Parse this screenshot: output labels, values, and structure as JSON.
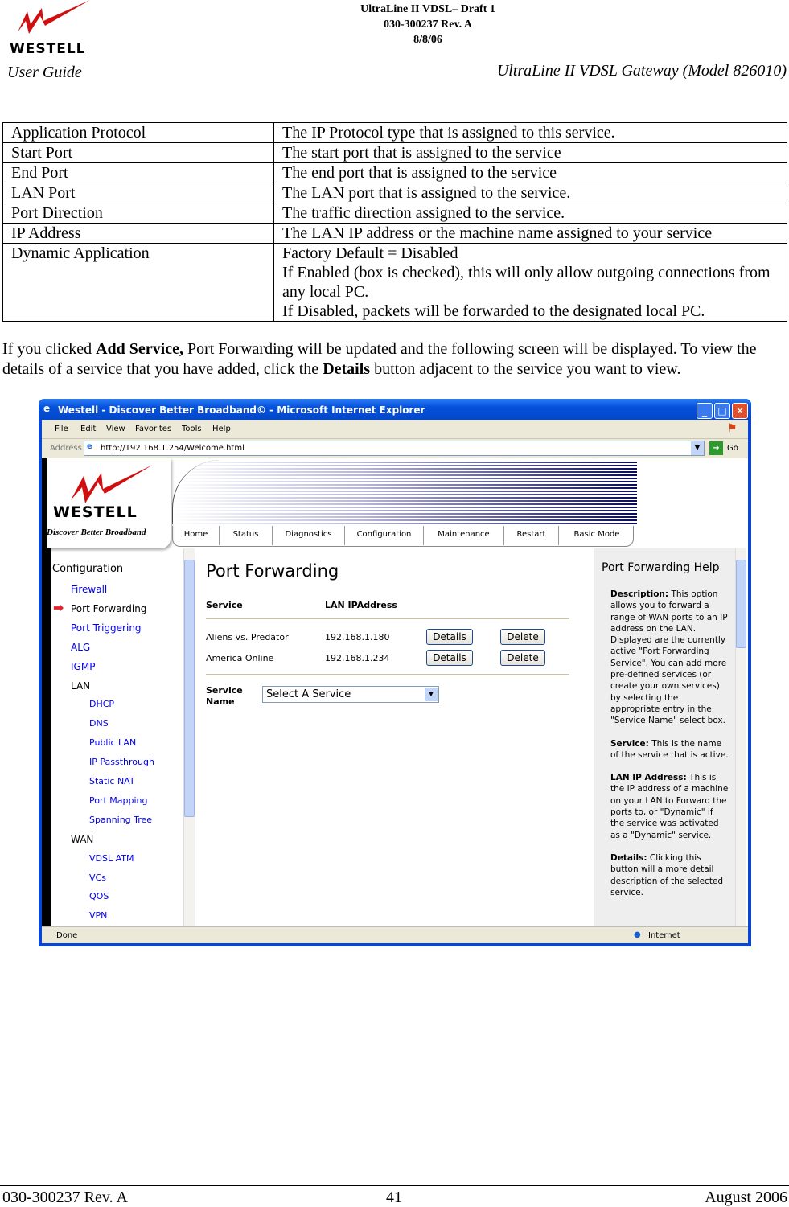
{
  "header": {
    "logo": "WESTELL",
    "line1": "UltraLine II VDSL– Draft 1",
    "line2": "030-300237 Rev. A",
    "line3": "8/8/06",
    "left": "User Guide",
    "right": "UltraLine II VDSL Gateway (Model 826010)"
  },
  "table": [
    {
      "term": "Application Protocol",
      "desc": [
        "The IP Protocol type that is assigned to this service."
      ]
    },
    {
      "term": "Start Port",
      "desc": [
        "The start port that is assigned to the service"
      ]
    },
    {
      "term": "End Port",
      "desc": [
        "The end port that is assigned to the service"
      ]
    },
    {
      "term": "LAN Port",
      "desc": [
        "The LAN port that is assigned to the service."
      ]
    },
    {
      "term": "Port Direction",
      "desc": [
        "The traffic direction assigned to the service."
      ]
    },
    {
      "term": "IP Address",
      "desc": [
        "The LAN IP address or the machine name assigned to your service"
      ]
    },
    {
      "term": "Dynamic Application",
      "desc": [
        "Factory Default = Disabled",
        "If Enabled (box is checked), this will only allow outgoing connections from any local PC.",
        "If Disabled, packets will be forwarded to the designated local PC."
      ]
    }
  ],
  "paragraph": {
    "p1": "If you clicked ",
    "b1": "Add Service,",
    "p2": " Port Forwarding will be updated and the following screen will be displayed. To view the details of a service that you have added, click the ",
    "b2": "Details",
    "p3": " button adjacent to the service you want to view."
  },
  "browser": {
    "title": "Westell - Discover Better Broadband© - Microsoft Internet Explorer",
    "menu": [
      "File",
      "Edit",
      "View",
      "Favorites",
      "Tools",
      "Help"
    ],
    "address_label": "Address",
    "url": "http://192.168.1.254/Welcome.html",
    "go": "Go",
    "status": "Done",
    "zone": "Internet"
  },
  "banner": {
    "logo": "WESTELL",
    "tagline": "Discover Better Broadband",
    "nav": [
      "Home",
      "Status",
      "Diagnostics",
      "Configuration",
      "Maintenance",
      "Restart",
      "Basic Mode"
    ]
  },
  "sidebar": {
    "heading": "Configuration",
    "items": [
      {
        "label": "Firewall",
        "level": 1,
        "link": true
      },
      {
        "label": "Port Forwarding",
        "level": 1,
        "link": false,
        "active": true
      },
      {
        "label": "Port Triggering",
        "level": 1,
        "link": true
      },
      {
        "label": "ALG",
        "level": 1,
        "link": true
      },
      {
        "label": "IGMP",
        "level": 1,
        "link": true
      },
      {
        "label": "LAN",
        "level": 1,
        "link": false
      },
      {
        "label": "DHCP",
        "level": 2,
        "link": true
      },
      {
        "label": "DNS",
        "level": 2,
        "link": true
      },
      {
        "label": "Public LAN",
        "level": 2,
        "link": true
      },
      {
        "label": "IP Passthrough",
        "level": 2,
        "link": true
      },
      {
        "label": "Static NAT",
        "level": 2,
        "link": true
      },
      {
        "label": "Port Mapping",
        "level": 2,
        "link": true
      },
      {
        "label": "Spanning Tree",
        "level": 2,
        "link": true
      },
      {
        "label": "WAN",
        "level": 1,
        "link": false
      },
      {
        "label": "VDSL ATM",
        "level": 2,
        "link": true
      },
      {
        "label": "VCs",
        "level": 2,
        "link": true
      },
      {
        "label": "QOS",
        "level": 2,
        "link": true
      },
      {
        "label": "VPN",
        "level": 2,
        "link": true
      }
    ]
  },
  "main": {
    "title": "Port Forwarding",
    "col_service": "Service",
    "col_ip": "LAN IPAddress",
    "rows": [
      {
        "service": "Aliens vs. Predator",
        "ip": "192.168.1.180"
      },
      {
        "service": "America Online",
        "ip": "192.168.1.234"
      }
    ],
    "details": "Details",
    "delete": "Delete",
    "service_name_label": "Service Name",
    "select_value": "Select A Service"
  },
  "help": {
    "title": "Port Forwarding Help",
    "items": [
      {
        "term": "Description:",
        "text": " This option allows you to forward a range of WAN ports to an IP address on the LAN. Displayed are the currently active \"Port Forwarding Service\". You can add more pre-defined services (or create your own services) by selecting the appropriate entry in the \"Service Name\" select box."
      },
      {
        "term": "Service:",
        "text": " This is the name of the service that is active."
      },
      {
        "term": "LAN IP Address:",
        "text": " This is the IP address of a machine on your LAN to Forward the ports to, or \"Dynamic\" if the service was activated as a \"Dynamic\" service."
      },
      {
        "term": "Details:",
        "text": " Clicking this button will a more detail description of the selected service."
      }
    ]
  },
  "footer": {
    "left": "030-300237 Rev. A",
    "center": "41",
    "right": "August 2006"
  }
}
